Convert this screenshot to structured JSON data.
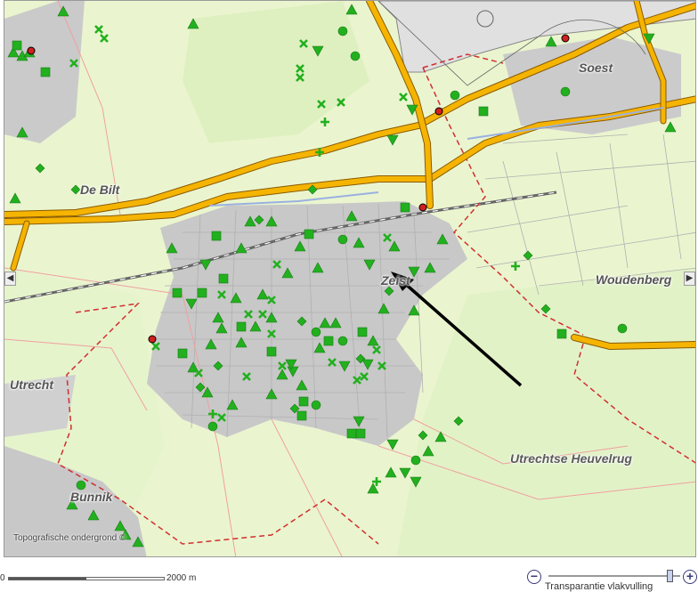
{
  "map": {
    "places": {
      "soest": "Soest",
      "de_bilt": "De Bilt",
      "zeist": "Zeist",
      "woudenberg": "Woudenberg",
      "utrecht": "Utrecht",
      "utrechtse_heuvelrug": "Utrechtse Heuvelrug",
      "bunnik": "Bunnik"
    },
    "attribution": "Topografische ondergrond ©",
    "colors": {
      "background": "#eaf5cf",
      "urban": "#c8c8c8",
      "motorway": "#f5b400",
      "marker": "#22b01e",
      "boundary": "#d03030",
      "pointer_arrow": "#000000"
    }
  },
  "pan": {
    "left": "◀",
    "right": "▶"
  },
  "scale": {
    "start": "0",
    "end": "2000 m"
  },
  "transparency": {
    "label": "Transparantie vlakvulling",
    "minus": "−",
    "plus": "+",
    "value_fraction": 0.92
  }
}
